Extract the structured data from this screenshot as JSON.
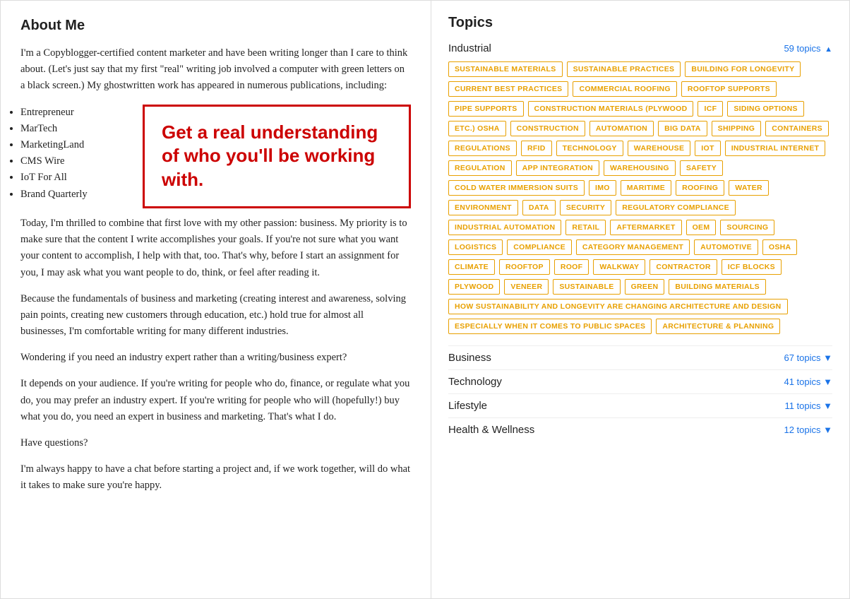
{
  "left": {
    "title": "About Me",
    "paragraphs": [
      "I'm a Copyblogger-certified content marketer and have been writing longer than I care to think about. (Let's just say that my first \"real\" writing job involved a computer with green letters on a black screen.)  My ghostwritten work has appeared in numerous publications, including:",
      "Today, I'm thrilled to combine that first love with my other passion: business. My priority is to make sure that the content I write accomplishes your goals. If you're not sure what you want your content to accomplish, I help with that, too. That's why, before I start an assignment for you, I may ask what you want people to do, think, or feel after reading it.",
      "Because the fundamentals of business and marketing (creating interest and awareness, solving pain points, creating new customers through education, etc.) hold true for almost all businesses, I'm comfortable writing for many different industries.",
      "Wondering if you need an industry expert rather than a writing/business expert?",
      "It depends on your audience. If you're writing for people who do, finance, or regulate what you do, you may prefer an industry expert. If you're writing for people who will (hopefully!) buy what you do, you need an expert in business and marketing. That's what I do.",
      "Have questions?",
      "I'm always happy to have a chat before starting a project and, if we work together, will do what it takes to make sure you're happy."
    ],
    "list_items": [
      "Entrepreneur",
      "MarTech",
      "MarketingLand",
      "CMS Wire",
      "IoT For All",
      "Brand Quarterly"
    ],
    "highlight_text": "Get a real understanding of who you'll be working with."
  },
  "right": {
    "title": "Topics",
    "industrial": {
      "name": "Industrial",
      "count": "59 topics",
      "tags": [
        "SUSTAINABLE MATERIALS",
        "SUSTAINABLE PRACTICES",
        "BUILDING FOR LONGEVITY",
        "CURRENT BEST PRACTICES",
        "COMMERCIAL ROOFING",
        "ROOFTOP SUPPORTS",
        "PIPE SUPPORTS",
        "CONSTRUCTION MATERIALS (PLYWOOD",
        "ICF",
        "SIDING OPTIONS",
        "ETC.) OSHA",
        "CONSTRUCTION",
        "AUTOMATION",
        "BIG DATA",
        "SHIPPING",
        "CONTAINERS",
        "REGULATIONS",
        "RFID",
        "TECHNOLOGY",
        "WAREHOUSE",
        "IOT",
        "INDUSTRIAL INTERNET",
        "REGULATION",
        "APP INTEGRATION",
        "WAREHOUSING",
        "SAFETY",
        "COLD WATER IMMERSION SUITS",
        "IMO",
        "MARITIME",
        "ROOFING",
        "WATER",
        "ENVIRONMENT",
        "DATA",
        "SECURITY",
        "REGULATORY COMPLIANCE",
        "INDUSTRIAL AUTOMATION",
        "RETAIL",
        "AFTERMARKET",
        "OEM",
        "SOURCING",
        "LOGISTICS",
        "COMPLIANCE",
        "CATEGORY MANAGEMENT",
        "AUTOMOTIVE",
        "OSHA",
        "CLIMATE",
        "ROOFTOP",
        "ROOF",
        "WALKWAY",
        "CONTRACTOR",
        "ICF BLOCKS",
        "PLYWOOD",
        "VENEER",
        "SUSTAINABLE",
        "GREEN",
        "BUILDING MATERIALS",
        "HOW SUSTAINABILITY AND LONGEVITY ARE CHANGING ARCHITECTURE AND DESIGN",
        "ESPECIALLY WHEN IT COMES TO PUBLIC SPACES",
        "ARCHITECTURE & PLANNING"
      ]
    },
    "other_sections": [
      {
        "name": "Business",
        "count": "67 topics"
      },
      {
        "name": "Technology",
        "count": "41 topics"
      },
      {
        "name": "Lifestyle",
        "count": "11 topics"
      },
      {
        "name": "Health & Wellness",
        "count": "12 topics"
      }
    ]
  }
}
